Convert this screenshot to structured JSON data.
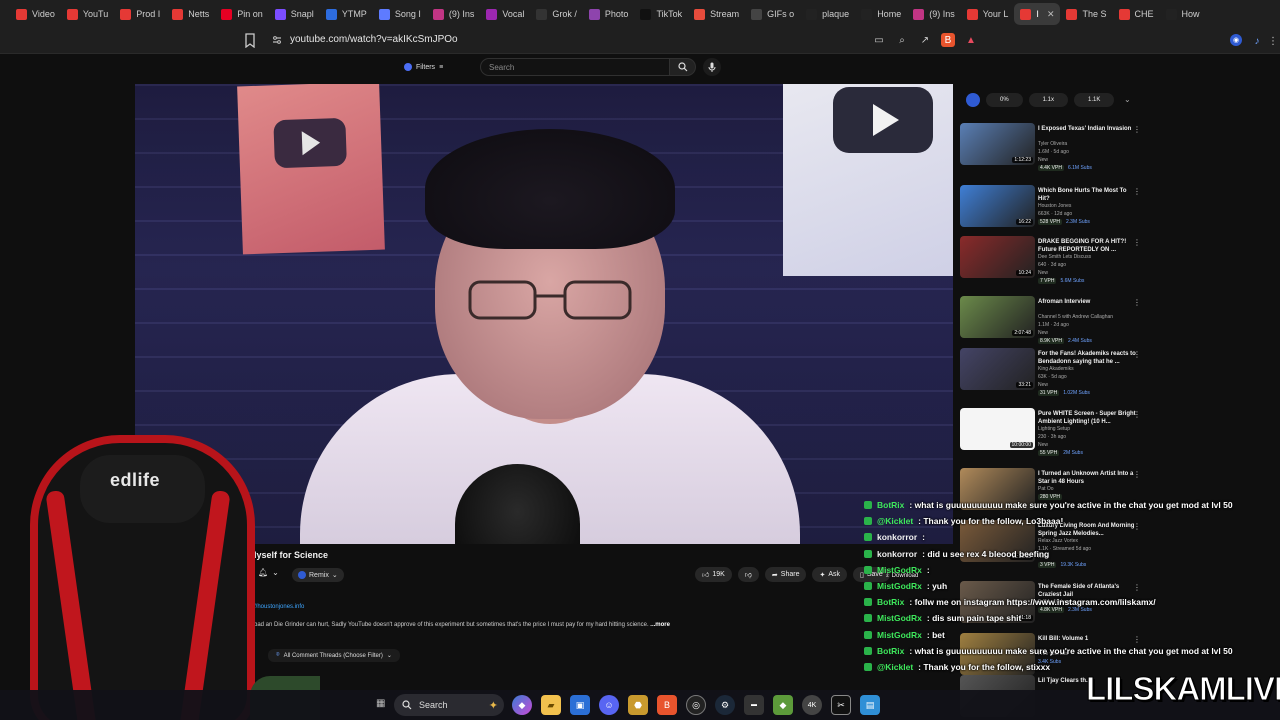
{
  "tabs": [
    {
      "label": "Video",
      "color": "#e53935"
    },
    {
      "label": "YouTu",
      "color": "#e53935"
    },
    {
      "label": "Prod I",
      "color": "#e53935"
    },
    {
      "label": "Netts",
      "color": "#e53935"
    },
    {
      "label": "Pin on",
      "color": "#e60023"
    },
    {
      "label": "Snapl",
      "color": "#7b4dff"
    },
    {
      "label": "YTMP",
      "color": "#2d6cdf"
    },
    {
      "label": "Song I",
      "color": "#5e7bff"
    },
    {
      "label": "(9) Ins",
      "color": "#c13584"
    },
    {
      "label": "Vocal",
      "color": "#9c27b0"
    },
    {
      "label": "Grok /",
      "color": "#333333"
    },
    {
      "label": "Photo",
      "color": "#8e44ad"
    },
    {
      "label": "TikTok",
      "color": "#111111"
    },
    {
      "label": "Stream",
      "color": "#e74c3c"
    },
    {
      "label": "GIFs o",
      "color": "#444444"
    },
    {
      "label": "plaque",
      "color": "#222222"
    },
    {
      "label": "Home",
      "color": "#222222"
    },
    {
      "label": "(9) Ins",
      "color": "#c13584"
    },
    {
      "label": "Your L",
      "color": "#e53935"
    },
    {
      "label": "I",
      "color": "#e53935",
      "active": true
    },
    {
      "label": "The S",
      "color": "#e53935"
    },
    {
      "label": "CHE",
      "color": "#e53935"
    },
    {
      "label": "How",
      "color": "#222222"
    }
  ],
  "address": {
    "url": "youtube.com/watch?v=akIKcSmJPOo"
  },
  "yt": {
    "filters_label": "Filters",
    "search_placeholder": "Search"
  },
  "video": {
    "title_visible": "lyself for Science",
    "remix_label": "Remix",
    "like_count": "19K",
    "share_label": "Share",
    "ask_label": "Ask",
    "save_label": "Save",
    "download_label": "Download",
    "desc_link": "//houstonjones.info",
    "desc_text": "bad an Die Grinder can hurt, Sadly YouTube doesn't approve of this experiment but sometimes that's the price I must pay for my hard hitting science.",
    "desc_more": "...more",
    "comments_sort": "All Comment Threads (Choose Filter)"
  },
  "speed": {
    "options": [
      "0%",
      "1.1x",
      "1.1K"
    ]
  },
  "recs": [
    {
      "title": "I Exposed Texas' Indian Invasion",
      "channel": "Tyler Oliveira",
      "meta": "1.6M · 5d ago",
      "badge": "New",
      "stat1": "4.4K VPH",
      "stat2": "6.1M Subs",
      "dur": "1:12:23",
      "color": "#5a7fb5"
    },
    {
      "title": "Which Bone Hurts The Most To Hit?",
      "channel": "Houston Jones",
      "meta": "663K · 12d ago",
      "badge": "",
      "stat1": "528 VPH",
      "stat2": "2.3M Subs",
      "dur": "16:22",
      "color": "#3f7fd6"
    },
    {
      "title": "DRAKE BEGGING FOR A HIT?! Future REPORTEDLY ON ...",
      "channel": "Dee Smith Lets Discuss",
      "meta": "640 · 3d ago",
      "badge": "New",
      "stat1": "7 VPH",
      "stat2": "5.6M Subs",
      "dur": "10:24",
      "color": "#8a2a2a"
    },
    {
      "title": "Afroman Interview",
      "channel": "Channel 5 with Andrew Callaghan",
      "meta": "1.1M · 2d ago",
      "badge": "New",
      "stat1": "8.9K VPH",
      "stat2": "2.4M Subs",
      "dur": "2:07:48",
      "color": "#6b8a4a"
    },
    {
      "title": "For the Fans! Akademiks reacts to Bendadonn saying that he ...",
      "channel": "King Akademiks",
      "meta": "63K · 5d ago",
      "badge": "New",
      "stat1": "31 VPH",
      "stat2": "1.02M Subs",
      "dur": "33:21",
      "color": "#444466"
    },
    {
      "title": "Pure WHITE Screen - Super Bright Ambient Lighting! (10 H...",
      "channel": "Lighting Setup",
      "meta": "230 · 3h ago",
      "badge": "New",
      "stat1": "55 VPH",
      "stat2": "2M Subs",
      "dur": "10:00:00",
      "color": "#f5f5f5"
    },
    {
      "title": "I Turned an Unknown Artist Into a Star in 48 Hours",
      "channel": "Pat Oo",
      "meta": "",
      "badge": "",
      "stat1": "280 VPH",
      "stat2": "",
      "dur": "",
      "color": "#b08a5a"
    },
    {
      "title": "Luxury Living Room And Morning Spring Jazz Melodies...",
      "channel": "Relax Jazz Vortex",
      "meta": "1.1K · Streamed 5d ago",
      "badge": "New",
      "stat1": "3 VPH",
      "stat2": "19.3K Subs",
      "dur": "11:10:05",
      "color": "#7a5a3a"
    },
    {
      "title": "The Female Side of Atlanta's Craziest Jail",
      "channel": "",
      "meta": "2.4M · 10d ago",
      "badge": "",
      "stat1": "4.8K VPH",
      "stat2": "2.3M Subs",
      "dur": "41:18",
      "color": "#6a5a4a"
    },
    {
      "title": "Kill Bill: Volume 1",
      "channel": "Free with ads",
      "meta": "",
      "badge": "",
      "stat1": "",
      "stat2": "3.4K Subs",
      "dur": "",
      "color": "#a08040"
    },
    {
      "title": "Lil Tjay Clears th...",
      "channel": "",
      "meta": "",
      "badge": "",
      "stat1": "",
      "stat2": "",
      "dur": "",
      "color": "#555555"
    }
  ],
  "chat": [
    {
      "user": "BotRix",
      "msg": ": what is guuuuuuuuuu make sure you're active in the chat you get mod at lvl 50",
      "ucolor": "green"
    },
    {
      "user": "@Kicklet",
      "msg": ": Thank you for the follow, Lo3baaa!",
      "ucolor": "green"
    },
    {
      "user": "konkorror",
      "msg": ":",
      "ucolor": "white"
    },
    {
      "user": "konkorror",
      "msg": ": did u see rex 4 bleood beefing",
      "ucolor": "white"
    },
    {
      "user": "MistGodRx",
      "msg": ":",
      "ucolor": "green"
    },
    {
      "user": "MistGodRx",
      "msg": ": yuh",
      "ucolor": "green"
    },
    {
      "user": "BotRix",
      "msg": ": follw me on instagram https://www.instagram.com/lilskamx/",
      "ucolor": "green"
    },
    {
      "user": "MistGodRx",
      "msg": ": dis sum pain tape shit",
      "ucolor": "green"
    },
    {
      "user": "MistGodRx",
      "msg": ": bet",
      "ucolor": "green"
    },
    {
      "user": "BotRix",
      "msg": ": what is guuuuuuuuuu make sure you're active in the chat you get mod at lvl 50",
      "ucolor": "green"
    },
    {
      "user": "@Kicklet",
      "msg": ": Thank you for the follow, stixxx",
      "ucolor": "green"
    }
  ],
  "chair": {
    "brand": "edlife"
  },
  "taskbar": {
    "search_label": "Search"
  },
  "watermark": "LILSKAMLIVE"
}
